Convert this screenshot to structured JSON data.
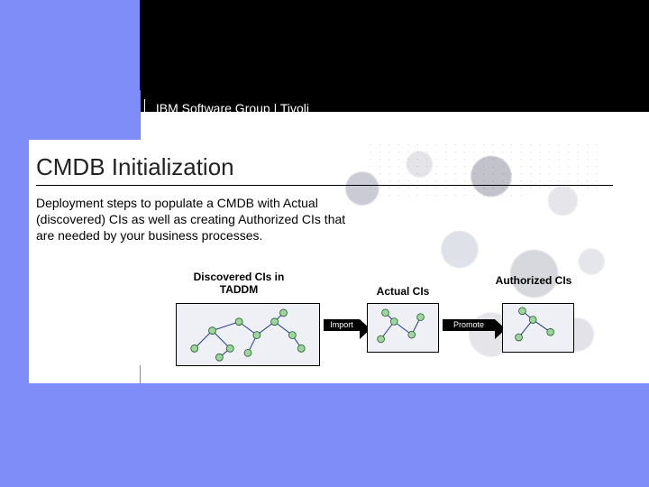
{
  "header": {
    "breadcrumb": "IBM Software Group  |  Tivoli"
  },
  "slide": {
    "title": "CMDB Initialization",
    "body": "Deployment steps to populate a CMDB with Actual (discovered) CIs as well as creating Authorized CIs that are needed by your business processes."
  },
  "diagram": {
    "stages": {
      "discovered": "Discovered CIs in TADDM",
      "actual": "Actual CIs",
      "authorized": "Authorized CIs"
    },
    "arrows": {
      "import": "Import",
      "promote": "Promote"
    }
  }
}
